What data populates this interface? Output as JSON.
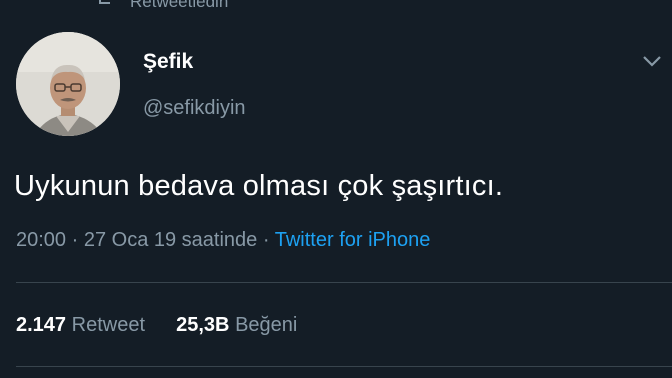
{
  "retweet_banner": {
    "text": "Retweetledin",
    "icon": "retweet-icon"
  },
  "author": {
    "name": "Şefik",
    "handle": "@sefikdiyin"
  },
  "tweet": {
    "text": "Uykunun bedava olması çok şaşırtıcı."
  },
  "meta": {
    "time": "20:00",
    "separator1": " · ",
    "date": "27 Oca 19 saatinde",
    "separator2": " · ",
    "source": "Twitter for iPhone"
  },
  "stats": {
    "retweets_count": "2.147",
    "retweets_label": "Retweet",
    "likes_count": "25,3B",
    "likes_label": "Beğeni"
  },
  "colors": {
    "background": "#141d26",
    "secondary_text": "#8899a6",
    "link": "#1da1f2",
    "divider": "#38444d"
  }
}
